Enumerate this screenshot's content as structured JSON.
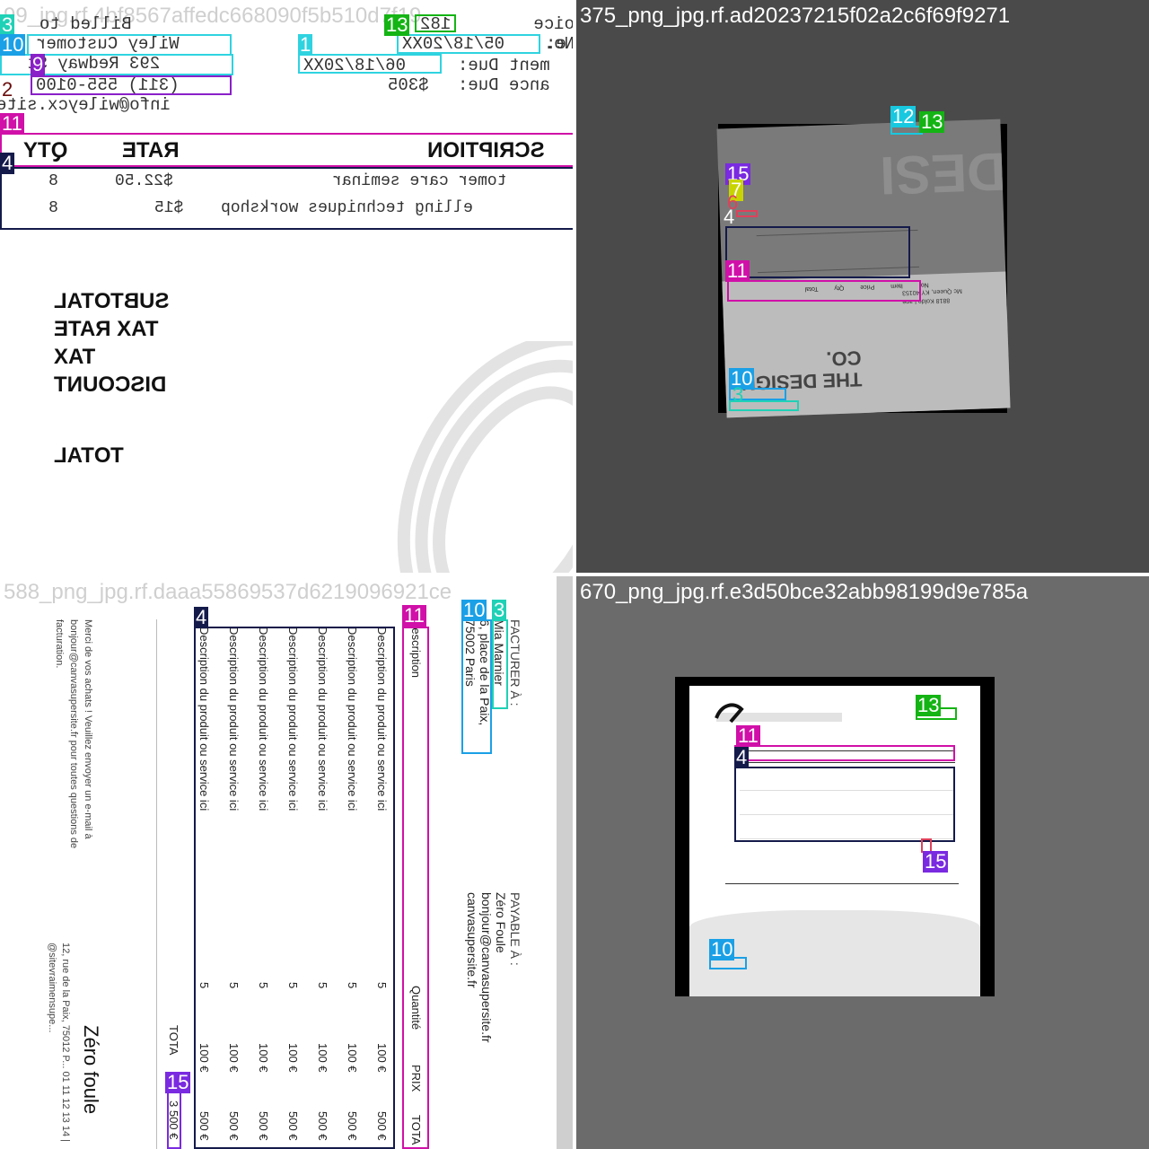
{
  "panels": {
    "p1": {
      "filename": "99_jpg.rf.4bf8567affedc668090f5b510d7f19",
      "header_billed_to": "Billed to",
      "header_invoice_no": "oice No.",
      "invoice_no": "182",
      "customer": "Wiley Customer",
      "address": "293 Redway St",
      "phone": "(311) 555-0100",
      "email": "info@wileycx.site",
      "date_label": "e:",
      "date_value": "05/18/20XX",
      "due_label": "ment Due:",
      "due_value": "06/18/20XX",
      "balance_label": "ance Due:",
      "balance_value": "$305",
      "col_desc": "SCRIPTION",
      "col_rate": "RATE",
      "col_qty": "QTY",
      "row1": {
        "desc": "tomer care seminar",
        "rate": "$22.50",
        "qty": "8"
      },
      "row2": {
        "desc": "elling techniques workshop",
        "rate": "$15",
        "qty": "8"
      },
      "subtotal": "SUBTOTAL",
      "tax_rate": "TAX RATE",
      "tax": "TAX",
      "discount": "DISCOUNT",
      "total": "TOTAL"
    },
    "p2": {
      "filename": "375_png_jpg.rf.ad20237215f02a2c6f69f9271",
      "company": "THE DESIGN CO.",
      "addr1": "8818 Koldo Lane",
      "addr2": "Mc Queen, KY 40153",
      "col1": "No.",
      "col2": "Item",
      "col3": "Price",
      "col4": "Qty",
      "col5": "Total"
    },
    "p3": {
      "filename": "588_png_jpg.rf.daaa55869537d6219096921ce",
      "bill_to": "FACTURER À :",
      "client": "Mia Marnier",
      "client_addr1": "6, place de la Paix,",
      "client_addr2": "75002 Paris",
      "payable": "PAYABLE À :",
      "payee": "Zéro Foule",
      "payee_email": "bonjour@canvasupersite.fr",
      "payee_site": "canvasupersite.fr",
      "col_desc": "Description",
      "col_qty": "Quantité",
      "col_price": "PRIX",
      "col_total": "TOTA",
      "row_desc": "Description du produit ou service ici",
      "row_qty": "5",
      "row_price": "100 €",
      "row_total": "500 €",
      "total_label": "TOTA",
      "total_value": "3 500 €",
      "thanks": "Merci de vos achats ! Veuillez envoyer un e-mail à bonjour@canvasupersite.fr pour toutes questions de facturation.",
      "brand": "Zéro foule",
      "footer": "12, rue de la Paix, 75012 P... 01 11 12 13 14 | @sitevraimensupe..."
    },
    "p4": {
      "filename": "670_png_jpg.rf.e3d50bce32abb98199d9e785a"
    }
  },
  "tags": [
    "1",
    "2",
    "3",
    "4",
    "6",
    "7",
    "9",
    "10",
    "11",
    "12",
    "13",
    "15"
  ],
  "colors": {
    "c1": "#2fd3e0",
    "c2": "#6b0c0c",
    "c3": "#1fd1b6",
    "c4": "#141a4a",
    "c6": "#e0405a",
    "c7": "#c8d400",
    "c9": "#8a20c8",
    "c10": "#1aa0e6",
    "c11": "#d010a8",
    "c12": "#18c8e0",
    "c13": "#14b414",
    "c15": "#7a2ae0"
  }
}
